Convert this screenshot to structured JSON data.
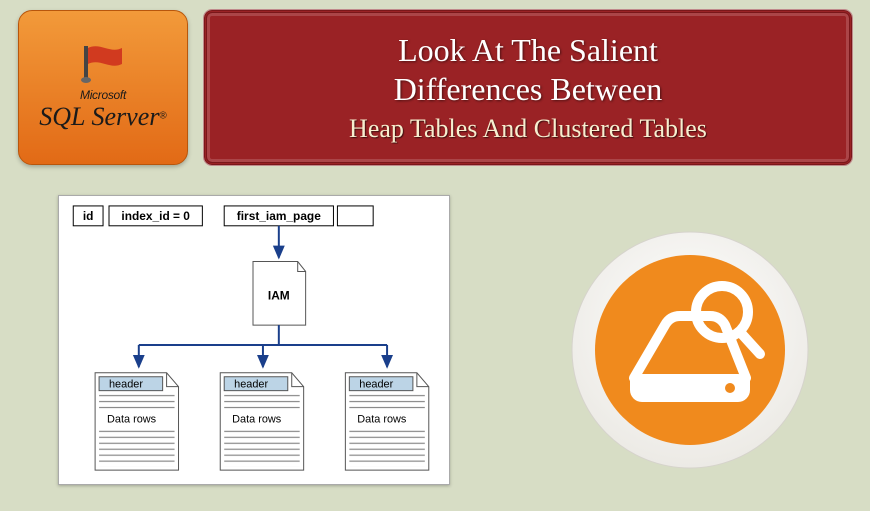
{
  "logo": {
    "company": "Microsoft",
    "product": "SQL Server",
    "trademark": "®"
  },
  "banner": {
    "line1": "Look At The Salient",
    "line2": "Differences Between",
    "subtitle": "Heap Tables And Clustered Tables"
  },
  "diagram": {
    "table_header": {
      "c1": "id",
      "c2": "index_id = 0",
      "c3": "first_iam_page"
    },
    "iam_label": "IAM",
    "page": {
      "header": "header",
      "body": "Data rows"
    }
  }
}
